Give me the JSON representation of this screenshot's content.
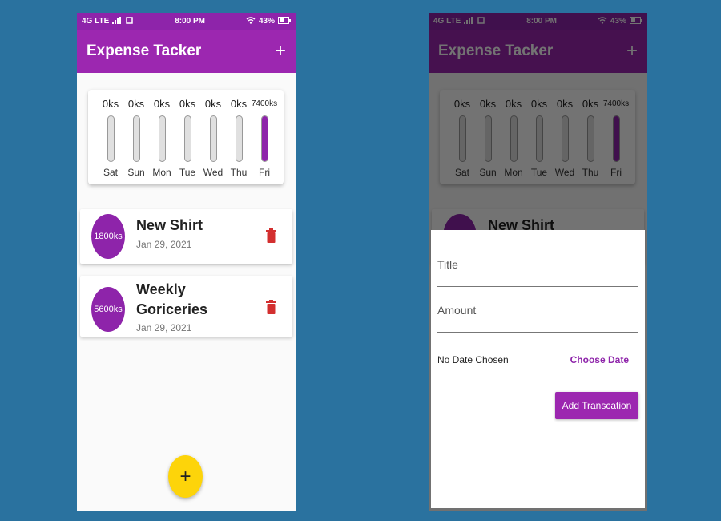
{
  "status_bar": {
    "network": "4G LTE",
    "time": "8:00 PM",
    "battery": "43%"
  },
  "app": {
    "title": "Expense Tacker",
    "add_icon": "+"
  },
  "chart_data": {
    "type": "bar",
    "categories": [
      "Sat",
      "Sun",
      "Mon",
      "Tue",
      "Wed",
      "Thu",
      "Fri"
    ],
    "values": [
      0,
      0,
      0,
      0,
      0,
      0,
      7400
    ],
    "labels": [
      "0ks",
      "0ks",
      "0ks",
      "0ks",
      "0ks",
      "0ks",
      "7400ks"
    ],
    "fill_fraction": [
      0,
      0,
      0,
      0,
      0,
      0,
      1
    ],
    "title": "",
    "xlabel": "",
    "ylabel": ""
  },
  "transactions": [
    {
      "amount": "1800ks",
      "title": "New Shirt",
      "date": "Jan 29, 2021"
    },
    {
      "amount": "5600ks",
      "title": "Weekly Goriceries",
      "date": "Jan 29, 2021"
    }
  ],
  "fab": {
    "label": "+"
  },
  "form": {
    "title_label": "Title",
    "amount_label": "Amount",
    "date_text": "No Date Chosen",
    "choose_date": "Choose Date",
    "submit": "Add Transcation"
  },
  "colors": {
    "primary": "#9c27b0",
    "accent": "#fdd40a",
    "background": "#2a729f",
    "delete": "#d32f2f"
  }
}
